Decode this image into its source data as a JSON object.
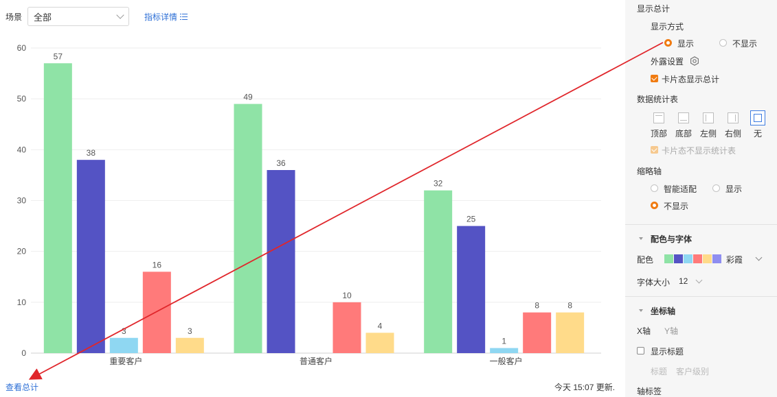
{
  "toolbar": {
    "scene_label": "场景",
    "scene_value": "全部",
    "detail_link": "指标详情",
    "list_icon": "list-icon"
  },
  "footer": {
    "view_total": "查看总计",
    "updated": "今天 15:07 更新."
  },
  "colors": {
    "green": "#8fe3a6",
    "purple": "#5453c4",
    "lightblue": "#8fd7f2",
    "red": "#ff7a7a",
    "yellow": "#ffdb8a",
    "lavender": "#8f8ef0",
    "accent_orange": "#f07b11",
    "link_blue": "#2d6fd6",
    "annotation_red": "#e0262b"
  },
  "chart_data": {
    "type": "bar",
    "categories": [
      "重要客户",
      "普通客户",
      "一般客户"
    ],
    "series": [
      {
        "values": [
          57,
          49,
          32
        ]
      },
      {
        "values": [
          38,
          36,
          25
        ]
      },
      {
        "values": [
          3,
          0,
          1
        ]
      },
      {
        "values": [
          16,
          10,
          8
        ]
      },
      {
        "values": [
          3,
          4,
          8
        ]
      }
    ],
    "ylim": [
      0,
      60
    ],
    "yticks": [
      0,
      10,
      20,
      30,
      40,
      50,
      60
    ],
    "grid": true,
    "legend": "none"
  },
  "panel": {
    "show_total_title": "显示总计",
    "display_mode_label": "显示方式",
    "opt_show": "显示",
    "opt_hide": "不显示",
    "exposure_label": "外露设置",
    "card_show_total": "卡片态显示总计",
    "data_table_label": "数据统计表",
    "positions": [
      "顶部",
      "底部",
      "左侧",
      "右侧",
      "无"
    ],
    "card_hide_table": "卡片态不显示统计表",
    "thumb_axis_label": "缩略轴",
    "thumb_smart": "智能适配",
    "thumb_show": "显示",
    "thumb_hide": "不显示",
    "color_font_section": "配色与字体",
    "palette_label": "配色",
    "palette_name": "彩霞",
    "font_size_label": "字体大小",
    "font_size_value": "12",
    "axis_section": "坐标轴",
    "axis_tab_x": "X轴",
    "axis_tab_y": "Y轴",
    "show_title": "显示标题",
    "title_label": "标题",
    "title_value": "客户级别",
    "axis_label_label": "轴标签"
  }
}
